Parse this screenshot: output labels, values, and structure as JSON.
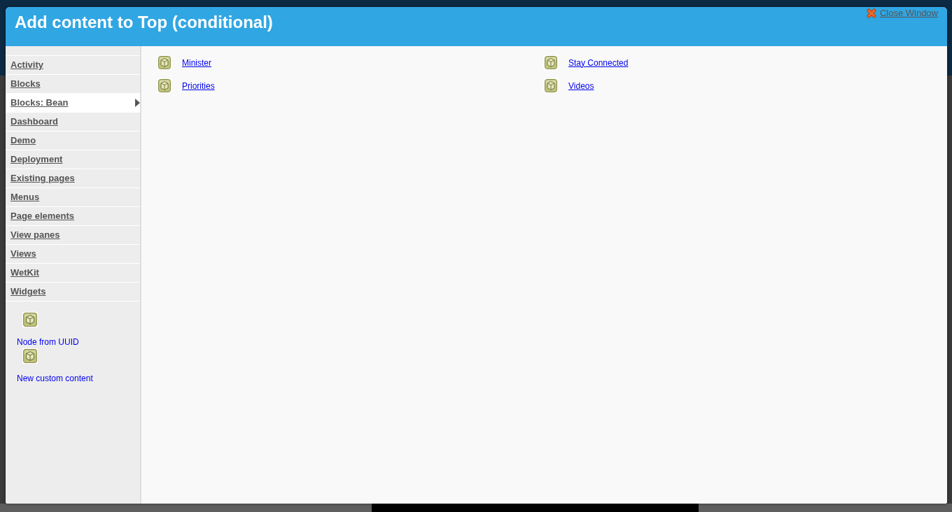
{
  "window": {
    "title": "Add content to Top (conditional)",
    "close_link": "Close Window"
  },
  "categories": [
    {
      "label": "Activity",
      "selected": false
    },
    {
      "label": "Blocks",
      "selected": false
    },
    {
      "label": "Blocks: Bean",
      "selected": true
    },
    {
      "label": "Dashboard",
      "selected": false
    },
    {
      "label": "Demo",
      "selected": false
    },
    {
      "label": "Deployment",
      "selected": false
    },
    {
      "label": "Existing pages",
      "selected": false
    },
    {
      "label": "Menus",
      "selected": false
    },
    {
      "label": "Page elements",
      "selected": false
    },
    {
      "label": "View panes",
      "selected": false
    },
    {
      "label": "Views",
      "selected": false
    },
    {
      "label": "WetKit",
      "selected": false
    },
    {
      "label": "Widgets",
      "selected": false
    }
  ],
  "sidebar_items": [
    {
      "label": "Node from UUID"
    },
    {
      "label": "New custom content"
    }
  ],
  "content_columns": [
    {
      "items": [
        {
          "label": "Minister"
        },
        {
          "label": "Priorities"
        }
      ]
    },
    {
      "items": [
        {
          "label": "Stay Connected"
        },
        {
          "label": "Videos"
        }
      ]
    }
  ]
}
